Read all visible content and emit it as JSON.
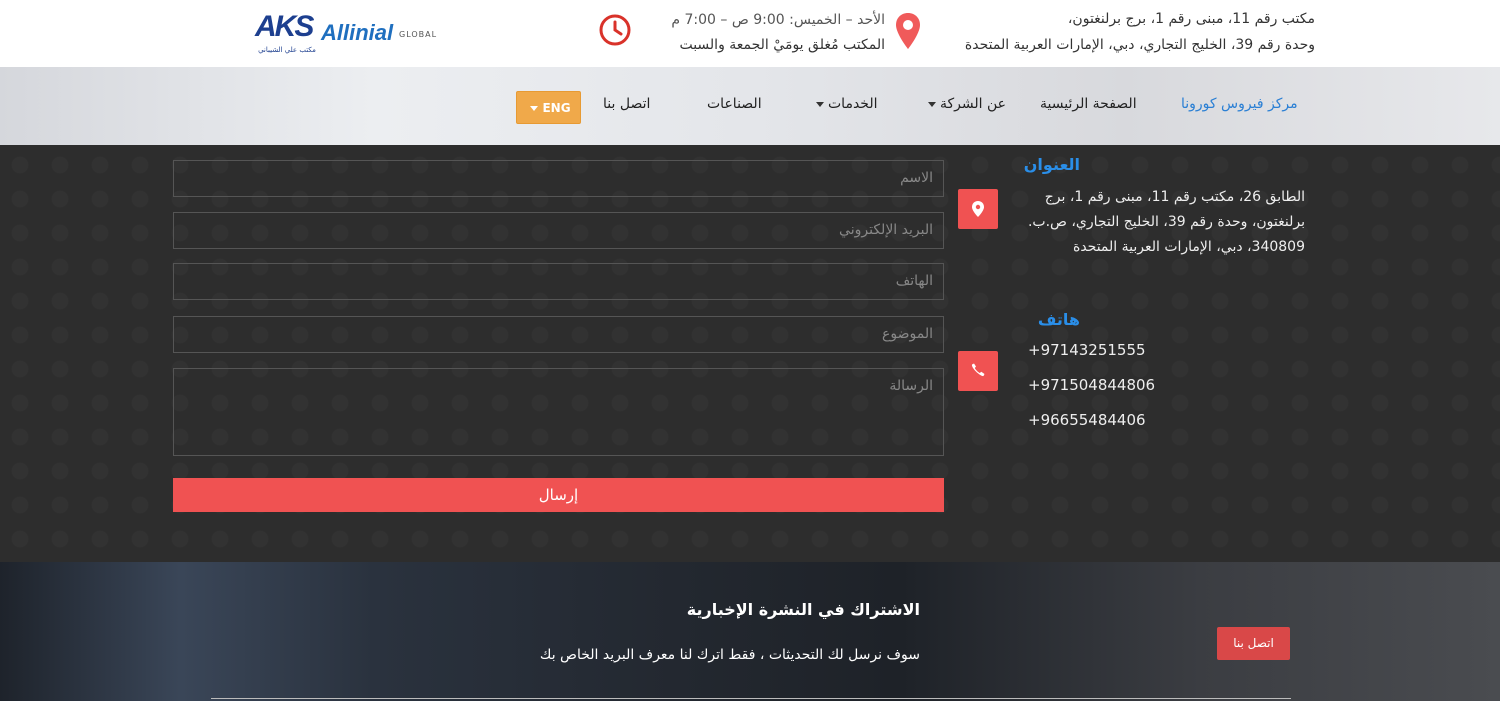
{
  "header": {
    "logo": {
      "aks": "AKS",
      "aks_subtitle": "مكتب علي الشيباني",
      "allinial": "Allinial",
      "global": "GLOBAL"
    },
    "hours": {
      "line1": "الأحد – الخميس: 9:00 ص – 7:00 م",
      "line2": "المكتب مُغلق يومَيْ الجمعة والسبت"
    },
    "address": {
      "line1": "مكتب رقم 11، مبنى رقم 1، برج برلنغتون،",
      "line2": "وحدة رقم 39، الخليج التجاري، دبي، الإمارات العربية المتحدة"
    }
  },
  "nav": {
    "items": [
      {
        "label": "مركز فيروس كورونا",
        "active": true
      },
      {
        "label": "الصفحة الرئيسية"
      },
      {
        "label": "عن الشركة"
      },
      {
        "label": "الخدمات"
      },
      {
        "label": "الصناعات"
      },
      {
        "label": "اتصل بنا"
      }
    ],
    "lang": "ENG"
  },
  "form": {
    "name_placeholder": "الاسم",
    "email_placeholder": "البريد الإلكتروني",
    "phone_placeholder": "الهاتف",
    "subject_placeholder": "الموضوع",
    "message_placeholder": "الرسالة",
    "submit": "إرسال"
  },
  "contact_info": {
    "address_title": "العنوان",
    "address_lines": [
      "الطابق 26، مكتب رقم 11، مبنى رقم 1، برج",
      "برلنغتون، وحدة رقم 39، الخليج التجاري، ص.ب.",
      "340809، دبي، الإمارات العربية المتحدة"
    ],
    "phone_title": "هاتف",
    "phones": [
      "+97143251555",
      "+971504844806",
      "+96655484406"
    ]
  },
  "newsletter": {
    "title": "الاشتراك في النشرة الإخبارية",
    "subtitle": "سوف نرسل لك التحديثات ، فقط اترك لنا معرف البريد الخاص بك",
    "button": "اتصل بنا"
  },
  "colors": {
    "accent_red": "#f05252",
    "link_blue": "#2a7fd4",
    "lang_orange": "#f0a94a"
  }
}
